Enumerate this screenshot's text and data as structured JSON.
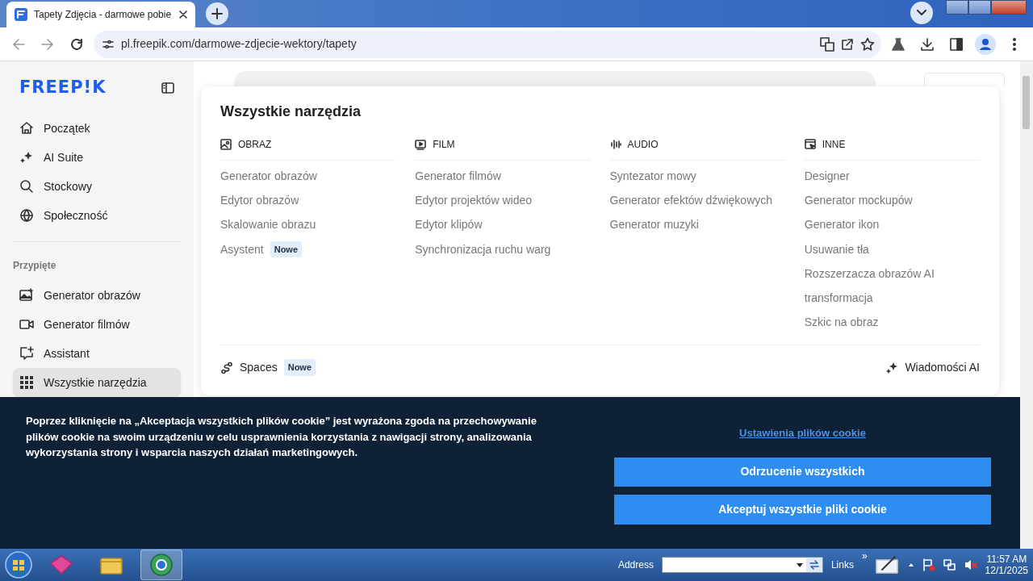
{
  "browser": {
    "tab_title": "Tapety Zdjęcia - darmowe pobie",
    "url": "pl.freepik.com/darmowe-zdjecie-wektory/tapety"
  },
  "sidebar": {
    "logo": "FREEP!K",
    "nav": [
      {
        "label": "Początek"
      },
      {
        "label": "AI Suite"
      },
      {
        "label": "Stockowy"
      },
      {
        "label": "Społeczność"
      }
    ],
    "pinned_heading": "Przypięte",
    "pinned": [
      {
        "label": "Generator obrazów",
        "selected": false
      },
      {
        "label": "Generator filmów",
        "selected": false
      },
      {
        "label": "Assistant",
        "selected": false
      },
      {
        "label": "Wszystkie narzędzia",
        "selected": true
      }
    ]
  },
  "tools_panel": {
    "title": "Wszystkie narzędzia",
    "columns": [
      {
        "heading": "OBRAZ",
        "items": [
          {
            "label": "Generator obrazów"
          },
          {
            "label": "Edytor obrazów"
          },
          {
            "label": "Skalowanie obrazu"
          },
          {
            "label": "Asystent",
            "badge": "Nowe"
          }
        ]
      },
      {
        "heading": "FILM",
        "items": [
          {
            "label": "Generator filmów"
          },
          {
            "label": "Edytor projektów wideo"
          },
          {
            "label": "Edytor klipów"
          },
          {
            "label": "Synchronizacja ruchu warg"
          }
        ]
      },
      {
        "heading": "AUDIO",
        "items": [
          {
            "label": "Syntezator mowy"
          },
          {
            "label": "Generator efektów dźwiękowych"
          },
          {
            "label": "Generator muzyki"
          }
        ]
      },
      {
        "heading": "INNE",
        "items": [
          {
            "label": "Designer"
          },
          {
            "label": "Generator mockupów"
          },
          {
            "label": "Generator ikon"
          },
          {
            "label": "Usuwanie tła"
          },
          {
            "label": "Rozszerzacza obrazów AI"
          },
          {
            "label": "transformacja"
          },
          {
            "label": "Szkic na obraz"
          }
        ]
      }
    ],
    "footer_left": {
      "label": "Spaces",
      "badge": "Nowe"
    },
    "footer_right": {
      "label": "Wiadomości AI"
    }
  },
  "cookie_banner": {
    "text": "Poprzez kliknięcie na „Akceptacja wszystkich plików cookie” jest wyrażona zgoda na przechowywanie plików cookie na swoim urządzeniu w celu usprawnienia korzystania z nawigacji strony, analizowania wykorzystania strony i wsparcia naszych działań marketingowych.",
    "settings_link": "Ustawienia plików cookie",
    "buttons": [
      "Odrzucenie wszystkich",
      "Akceptuj wszystkie pliki cookie"
    ]
  },
  "taskbar": {
    "address_label": "Address",
    "links_label": "Links",
    "chevron": "»",
    "time": "11:57 AM",
    "date": "12/1/2025"
  }
}
